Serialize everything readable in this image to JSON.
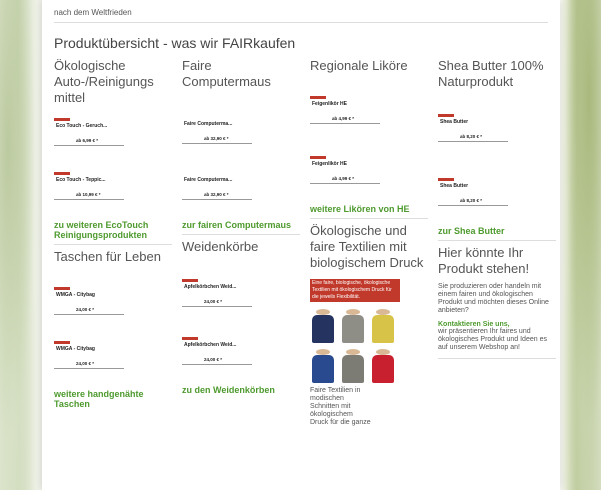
{
  "top_note": "nach dem Weltfrieden",
  "title": "Produktübersicht - was wir FAIRkaufen",
  "columns": {
    "c1": {
      "heading": "Ökologische Auto-/Reinigungs mittel",
      "products": [
        {
          "name": "Eco Touch - Geruch...",
          "price": "ab 6,99 € *"
        },
        {
          "name": "Eco Touch - Teppic...",
          "price": "ab 10,99 € *"
        }
      ],
      "link": "zu weiteren EcoTouch Reinigungsprodukten",
      "heading2": "Taschen für Leben",
      "products2": [
        {
          "name": "WMGA - Citybag",
          "price": "24,00 € *"
        },
        {
          "name": "WMGA - Citybag",
          "price": "24,00 € *"
        }
      ],
      "link2": "weitere handgenähte Taschen"
    },
    "c2": {
      "heading": "Faire Computermaus",
      "products": [
        {
          "name": "Faire Computerma...",
          "price": "ab 32,90 € *"
        },
        {
          "name": "Faire Computerma...",
          "price": "ab 32,90 € *"
        }
      ],
      "link": "zur fairen Computermaus",
      "heading2": "Weidenkörbe",
      "products2": [
        {
          "name": "Apfelkörbchen Weid...",
          "price": "24,00 € *"
        },
        {
          "name": "Apfelkörbchen Weid...",
          "price": "24,00 € *"
        }
      ],
      "link2": "zu den Weidenkörben"
    },
    "c3": {
      "heading": "Regionale Liköre",
      "products": [
        {
          "name": "Feigenlikör HE",
          "price": "ab 4,99 € *"
        },
        {
          "name": "Feigenlikör HE",
          "price": "ab 4,99 € *"
        }
      ],
      "link": "weitere Likören von HE",
      "heading2": "Ökologische und faire Textilien mit biologischem Druck",
      "highlight": "Eine faire, biologische, ökologische Textilien mit ökologischem Druck für die jeweils Flexibilität.",
      "shirt_colors": [
        "#24335f",
        "#8e8e86",
        "#d8c349",
        "#2a4a8f",
        "#7c7c74",
        "#c8202e"
      ],
      "caption": "Faire Textilien in modischen Schnitten mit ökologischem Druck für die ganze"
    },
    "c4": {
      "heading": "Shea Butter 100% Naturprodukt",
      "products": [
        {
          "name": "Shea Butter",
          "price": "ab 8,20 € *"
        },
        {
          "name": "Shea Butter",
          "price": "ab 8,20 € *"
        }
      ],
      "link": "zur Shea Butter",
      "heading2": "Hier könnte Ihr Produkt stehen!",
      "para1": "Sie produzieren oder handeln mit einem fairen und ökologischen Produkt und möchten dieses Online anbieten?",
      "contact": "Kontaktieren Sie uns,",
      "para2": "wir präsentieren Ihr faires und ökologisches Produkt und Ideen es auf unserem Webshop an!"
    }
  }
}
